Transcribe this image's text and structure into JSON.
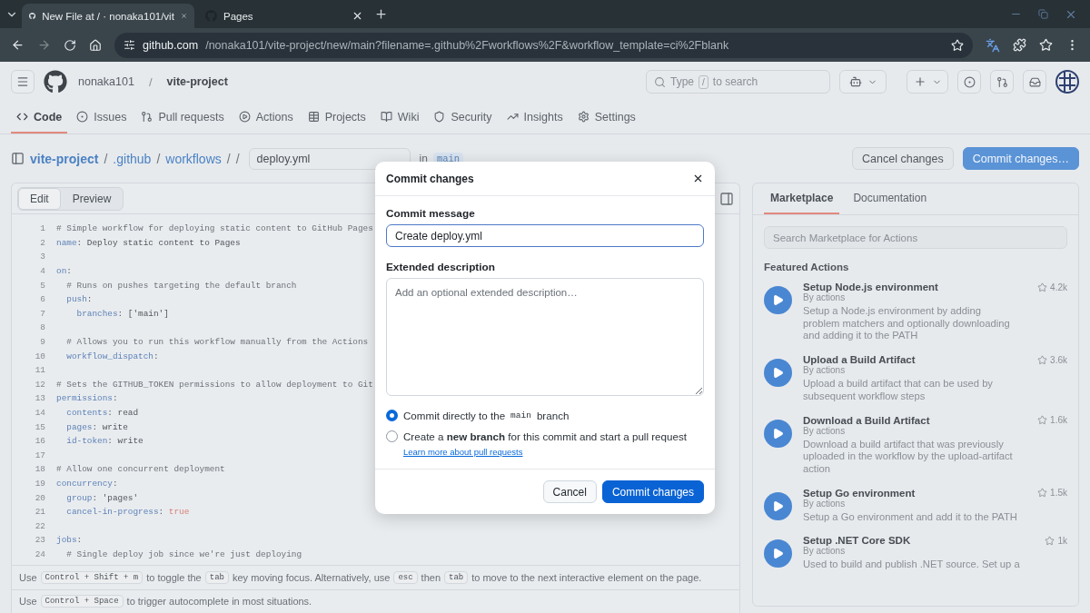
{
  "browser": {
    "tabs": [
      {
        "title": "New File at / · nonaka101/vit",
        "selected": true
      },
      {
        "title": "Pages",
        "selected": false
      }
    ],
    "url_host": "github.com",
    "url_path": "/nonaka101/vite-project/new/main?filename=.github%2Fworkflows%2F&workflow_template=ci%2Fblank"
  },
  "header": {
    "owner": "nonaka101",
    "separator": "/",
    "repo": "vite-project",
    "search": {
      "before": "Type",
      "key": "/",
      "after": "to search"
    }
  },
  "repo_nav": [
    {
      "label": "Code",
      "selected": true
    },
    {
      "label": "Issues",
      "selected": false
    },
    {
      "label": "Pull requests",
      "selected": false
    },
    {
      "label": "Actions",
      "selected": false
    },
    {
      "label": "Projects",
      "selected": false
    },
    {
      "label": "Wiki",
      "selected": false
    },
    {
      "label": "Security",
      "selected": false
    },
    {
      "label": "Insights",
      "selected": false
    },
    {
      "label": "Settings",
      "selected": false
    }
  ],
  "breadcrumb": {
    "parts": [
      {
        "text": "vite-project",
        "kind": "repo"
      },
      {
        "text": "/",
        "kind": "sep"
      },
      {
        "text": ".github",
        "kind": "link"
      },
      {
        "text": "/",
        "kind": "sep"
      },
      {
        "text": "workflows",
        "kind": "link"
      },
      {
        "text": "/",
        "kind": "sep"
      },
      {
        "text": "/",
        "kind": "sep"
      }
    ],
    "filename": "deploy.yml",
    "in": "in",
    "branch": "main"
  },
  "actions": [
    {
      "label": "Cancel changes",
      "kind": "secondary"
    },
    {
      "label": "Commit changes…",
      "kind": "primary"
    }
  ],
  "editor": {
    "tabs": [
      {
        "label": "Edit",
        "selected": true
      },
      {
        "label": "Preview",
        "selected": false
      }
    ],
    "lines": [
      {
        "number": "1",
        "tokens": [
          {
            "kind": "comment",
            "text": "# Simple workflow for deploying static content to GitHub Pages"
          }
        ]
      },
      {
        "number": "2",
        "tokens": [
          {
            "kind": "key",
            "text": "name"
          },
          {
            "kind": "plain",
            "text": ": Deploy static content to Pages"
          }
        ]
      },
      {
        "number": "3"
      },
      {
        "number": "4",
        "tokens": [
          {
            "kind": "key",
            "text": "on"
          },
          {
            "kind": "plain",
            "text": ":"
          }
        ]
      },
      {
        "number": "5",
        "tokens": [
          {
            "kind": "comment",
            "text": "  # Runs on pushes targeting the default branch"
          }
        ]
      },
      {
        "number": "6",
        "tokens": [
          {
            "kind": "key",
            "text": "  push"
          },
          {
            "kind": "plain",
            "text": ":"
          }
        ]
      },
      {
        "number": "7",
        "tokens": [
          {
            "kind": "key",
            "text": "    branches"
          },
          {
            "kind": "plain",
            "text": ": ['main']"
          }
        ]
      },
      {
        "number": "8"
      },
      {
        "number": "9",
        "tokens": [
          {
            "kind": "comment",
            "text": "  # Allows you to run this workflow manually from the Actions"
          }
        ]
      },
      {
        "number": "10",
        "tokens": [
          {
            "kind": "key",
            "text": "  workflow_dispatch"
          },
          {
            "kind": "plain",
            "text": ":"
          }
        ]
      },
      {
        "number": "11"
      },
      {
        "number": "12",
        "tokens": [
          {
            "kind": "comment",
            "text": "# Sets the GITHUB_TOKEN permissions to allow deployment to Git"
          }
        ]
      },
      {
        "number": "13",
        "tokens": [
          {
            "kind": "key",
            "text": "permissions"
          },
          {
            "kind": "plain",
            "text": ":"
          }
        ]
      },
      {
        "number": "14",
        "tokens": [
          {
            "kind": "key",
            "text": "  contents"
          },
          {
            "kind": "plain",
            "text": ": read"
          }
        ]
      },
      {
        "number": "15",
        "tokens": [
          {
            "kind": "key",
            "text": "  pages"
          },
          {
            "kind": "plain",
            "text": ": write"
          }
        ]
      },
      {
        "number": "16",
        "tokens": [
          {
            "kind": "key",
            "text": "  id-token"
          },
          {
            "kind": "plain",
            "text": ": write"
          }
        ]
      },
      {
        "number": "17"
      },
      {
        "number": "18",
        "tokens": [
          {
            "kind": "comment",
            "text": "# Allow one concurrent deployment"
          }
        ]
      },
      {
        "number": "19",
        "tokens": [
          {
            "kind": "key",
            "text": "concurrency"
          },
          {
            "kind": "plain",
            "text": ":"
          }
        ]
      },
      {
        "number": "20",
        "tokens": [
          {
            "kind": "key",
            "text": "  group"
          },
          {
            "kind": "plain",
            "text": ": 'pages'"
          }
        ]
      },
      {
        "number": "21",
        "tokens": [
          {
            "kind": "key",
            "text": "  cancel-in-progress"
          },
          {
            "kind": "plain",
            "text": ": "
          },
          {
            "kind": "bool",
            "text": "true"
          }
        ]
      },
      {
        "number": "22"
      },
      {
        "number": "23",
        "tokens": [
          {
            "kind": "key",
            "text": "jobs"
          },
          {
            "kind": "plain",
            "text": ":"
          }
        ]
      },
      {
        "number": "24",
        "tokens": [
          {
            "kind": "comment",
            "text": "  # Single deploy job since we're just deploying"
          }
        ]
      }
    ],
    "hints": [
      [
        {
          "kind": "text",
          "text": "Use"
        },
        {
          "kind": "key",
          "text": "Control + Shift + m"
        },
        {
          "kind": "text",
          "text": "to toggle the"
        },
        {
          "kind": "key",
          "text": "tab"
        },
        {
          "kind": "text",
          "text": "key moving focus. Alternatively, use"
        },
        {
          "kind": "key",
          "text": "esc"
        },
        {
          "kind": "text",
          "text": "then"
        },
        {
          "kind": "key",
          "text": "tab"
        },
        {
          "kind": "text",
          "text": "to move to the next interactive element on the page."
        }
      ],
      [
        {
          "kind": "text",
          "text": "Use"
        },
        {
          "kind": "key",
          "text": "Control + Space"
        },
        {
          "kind": "text",
          "text": "to trigger autocomplete in most situations."
        }
      ]
    ]
  },
  "modal": {
    "title": "Commit changes",
    "message_label": "Commit message",
    "message_value": "Create deploy.yml",
    "description_label": "Extended description",
    "description_placeholder": "Add an optional extended description…",
    "options": [
      {
        "segments": [
          {
            "kind": "text",
            "text": "Commit directly to the"
          },
          {
            "kind": "code",
            "text": "main"
          },
          {
            "kind": "text",
            "text": "branch"
          }
        ],
        "selected": true
      },
      {
        "segments": [
          {
            "kind": "text",
            "text": "Create a **new branch** for this commit and start a pull request"
          }
        ],
        "selected": false,
        "link": "Learn more about pull requests"
      }
    ],
    "buttons": [
      {
        "label": "Cancel",
        "kind": "secondary"
      },
      {
        "label": "Commit changes",
        "kind": "primary"
      }
    ]
  },
  "sidebar": {
    "tabs": [
      {
        "label": "Marketplace",
        "selected": true
      },
      {
        "label": "Documentation",
        "selected": false
      }
    ],
    "search_placeholder": "Search Marketplace for Actions",
    "heading": "Featured Actions",
    "actions": [
      {
        "title": "Setup Node.js environment",
        "by": "By actions",
        "description": "Setup a Node.js environment by adding problem matchers and optionally downloading and adding it to the PATH",
        "stars": "4.2k"
      },
      {
        "title": "Upload a Build Artifact",
        "by": "By actions",
        "description": "Upload a build artifact that can be used by subsequent workflow steps",
        "stars": "3.6k"
      },
      {
        "title": "Download a Build Artifact",
        "by": "By actions",
        "description": "Download a build artifact that was previously uploaded in the workflow by the upload-artifact action",
        "stars": "1.6k"
      },
      {
        "title": "Setup Go environment",
        "by": "By actions",
        "description": "Setup a Go environment and add it to the PATH",
        "stars": "1.5k"
      },
      {
        "title": "Setup .NET Core SDK",
        "by": "By actions",
        "description": "Used to build and publish .NET source. Set up a",
        "stars": "1k"
      }
    ]
  }
}
